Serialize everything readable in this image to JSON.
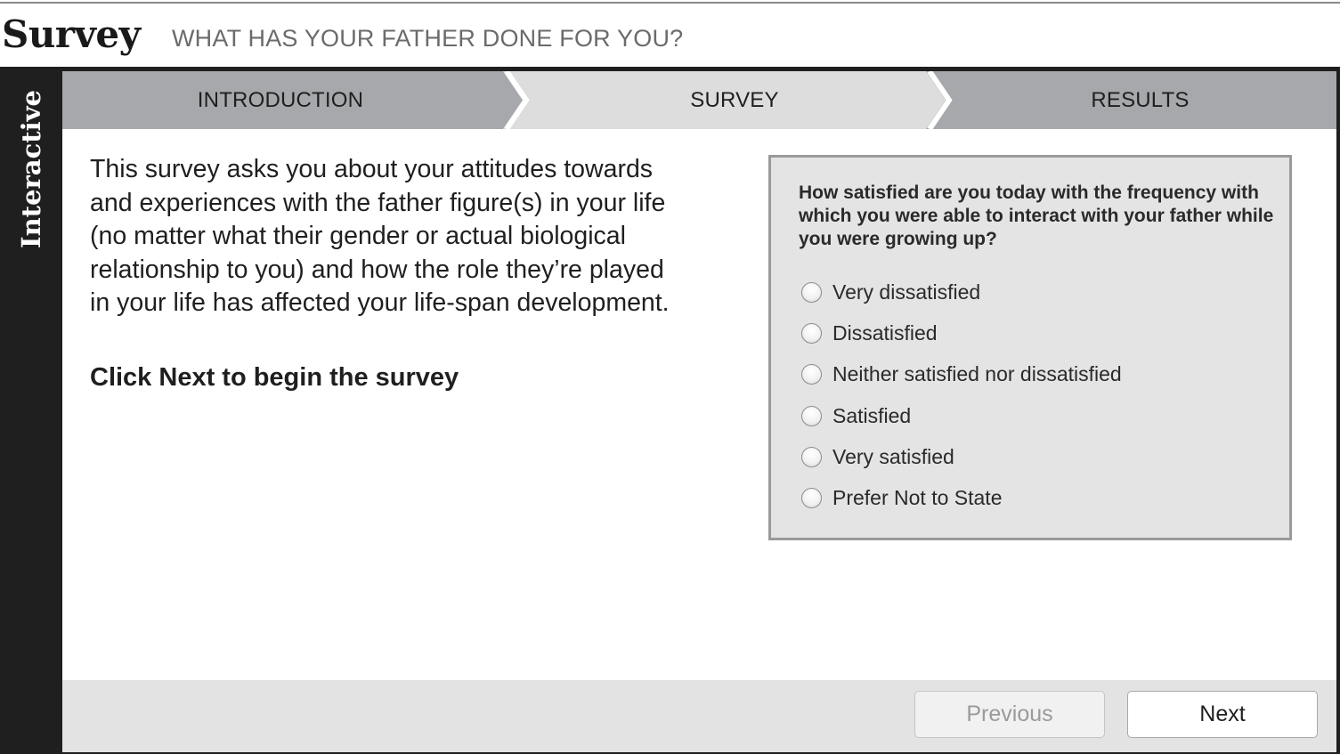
{
  "header": {
    "title": "Survey",
    "subtitle": "WHAT HAS YOUR FATHER DONE FOR YOU?"
  },
  "sidebar": {
    "label": "Interactive"
  },
  "tabs": [
    {
      "label": "INTRODUCTION",
      "active": true
    },
    {
      "label": "SURVEY",
      "active": false
    },
    {
      "label": "RESULTS",
      "active": false
    }
  ],
  "intro": {
    "paragraph": "This survey asks you about your attitudes towards and experiences with the father figure(s) in your life (no matter what their gender or actual biological relationship to you) and how the role they’re played in your life has affected your life-span development.",
    "cta": "Click Next to begin the survey"
  },
  "question": {
    "text": "How satisfied are you today with the frequency with which you were able to interact with your father while you were growing up?",
    "options": [
      "Very dissatisfied",
      "Dissatisfied",
      "Neither satisfied nor dissatisfied",
      "Satisfied",
      "Very satisfied",
      "Prefer Not to State"
    ]
  },
  "footer": {
    "previous_label": "Previous",
    "next_label": "Next"
  },
  "colors": {
    "tab_active": "#a6a8ab",
    "tab_inactive": "#dddddd",
    "tab_separator": "#ffffff",
    "frame": "#1f1f1f",
    "question_bg": "#e4e4e4",
    "footer_bg": "#e3e3e3"
  }
}
